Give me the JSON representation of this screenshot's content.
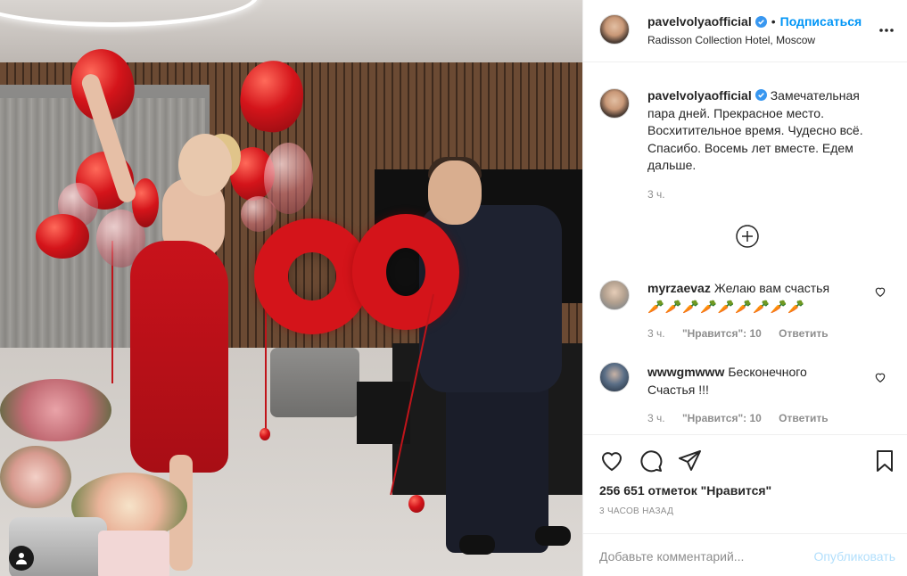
{
  "post": {
    "author": "pavelvolyaofficial",
    "follow_label": "Подписаться",
    "separator": "•",
    "location": "Radisson Collection Hotel, Moscow"
  },
  "caption": {
    "username": "pavelvolyaofficial",
    "text": "Замечательная пара дней. Прекрасное место. Восхитительное время. Чудесно всё. Спасибо. Восемь лет вместе. Едем дальше.",
    "time": "3 ч."
  },
  "comments": [
    {
      "username": "myrzaevaz",
      "text": "Желаю вам счастья",
      "emoji": "🥕🥕🥕🥕🥕🥕🥕🥕🥕",
      "time": "3 ч.",
      "likes": "\"Нравится\": 10",
      "reply": "Ответить"
    },
    {
      "username": "wwwgmwww",
      "text": "Бесконечного Счастья !!!",
      "time": "3 ч.",
      "likes": "\"Нравится\": 10",
      "reply": "Ответить"
    }
  ],
  "footer": {
    "likes_count": "256 651 отметок \"Нравится\"",
    "time_ago": "3 ЧАСОВ НАЗАД",
    "comment_placeholder": "Добавьте комментарий...",
    "post_label": "Опубликовать"
  },
  "icons": {
    "verified": "verified-badge-icon",
    "more": "more-options-icon",
    "load_more": "plus-circle-icon",
    "like": "heart-icon",
    "comment": "comment-icon",
    "share": "share-icon",
    "save": "bookmark-icon",
    "user_tag": "user-tag-icon"
  },
  "colors": {
    "link_blue": "#0095f6",
    "post_disabled": "#b2dffc",
    "verified_blue": "#3897f0",
    "secondary_text": "#8e8e8e",
    "border": "#efefef"
  }
}
